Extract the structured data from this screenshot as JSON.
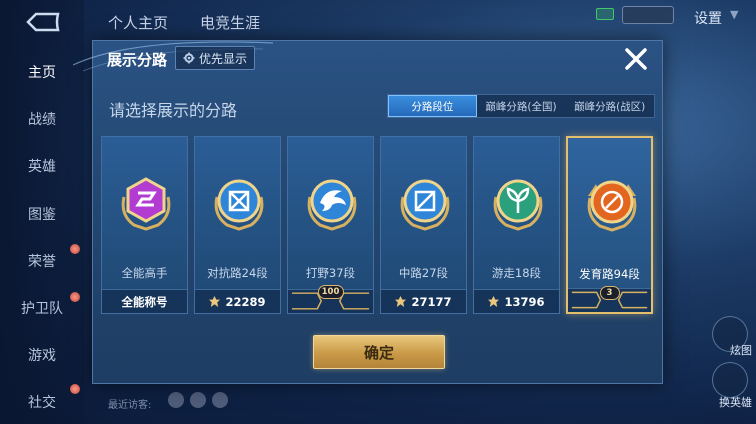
{
  "background": {
    "sidebar_items": [
      {
        "label": "主页",
        "active": true
      },
      {
        "label": "战绩"
      },
      {
        "label": "英雄"
      },
      {
        "label": "图鉴"
      },
      {
        "label": "荣誉"
      },
      {
        "label": "护卫队"
      },
      {
        "label": "游戏"
      },
      {
        "label": "社交"
      }
    ],
    "top_tabs": [
      "个人主页",
      "电竞生涯"
    ],
    "settings_label": "设置",
    "right_labels": [
      "炫图",
      "换英雄"
    ],
    "recent_visitors_label": "最近访客:"
  },
  "modal": {
    "title": "展示分路",
    "priority_button": "优先显示",
    "prompt": "请选择展示的分路",
    "tabs": [
      {
        "label": "分路段位",
        "active": true
      },
      {
        "label": "巅峰分路(全国)",
        "active": false
      },
      {
        "label": "巅峰分路(战区)",
        "active": false
      }
    ],
    "cards": [
      {
        "name": "全能高手",
        "foot": "全能称号",
        "badge_color": "#b23bd1",
        "icon": "allround-badge-icon"
      },
      {
        "name": "对抗路24段",
        "foot": "22289",
        "badge_color": "#2f86d8",
        "icon": "clash-lane-badge-icon"
      },
      {
        "name": "打野37段",
        "plate": "100",
        "badge_color": "#2f86d8",
        "icon": "jungle-badge-icon"
      },
      {
        "name": "中路27段",
        "foot": "27177",
        "badge_color": "#2f86d8",
        "icon": "mid-lane-badge-icon"
      },
      {
        "name": "游走18段",
        "foot": "13796",
        "badge_color": "#2aa07c",
        "icon": "roam-badge-icon"
      },
      {
        "name": "发育路94段",
        "plate": "3",
        "badge_color": "#e2661f",
        "icon": "farm-lane-badge-icon",
        "selected": true
      }
    ],
    "confirm_label": "确定"
  },
  "colors": {
    "accent_gold": "#e4bf6e",
    "active_tab_blue": "#3b8fe0",
    "panel_blue": "#23466f"
  }
}
